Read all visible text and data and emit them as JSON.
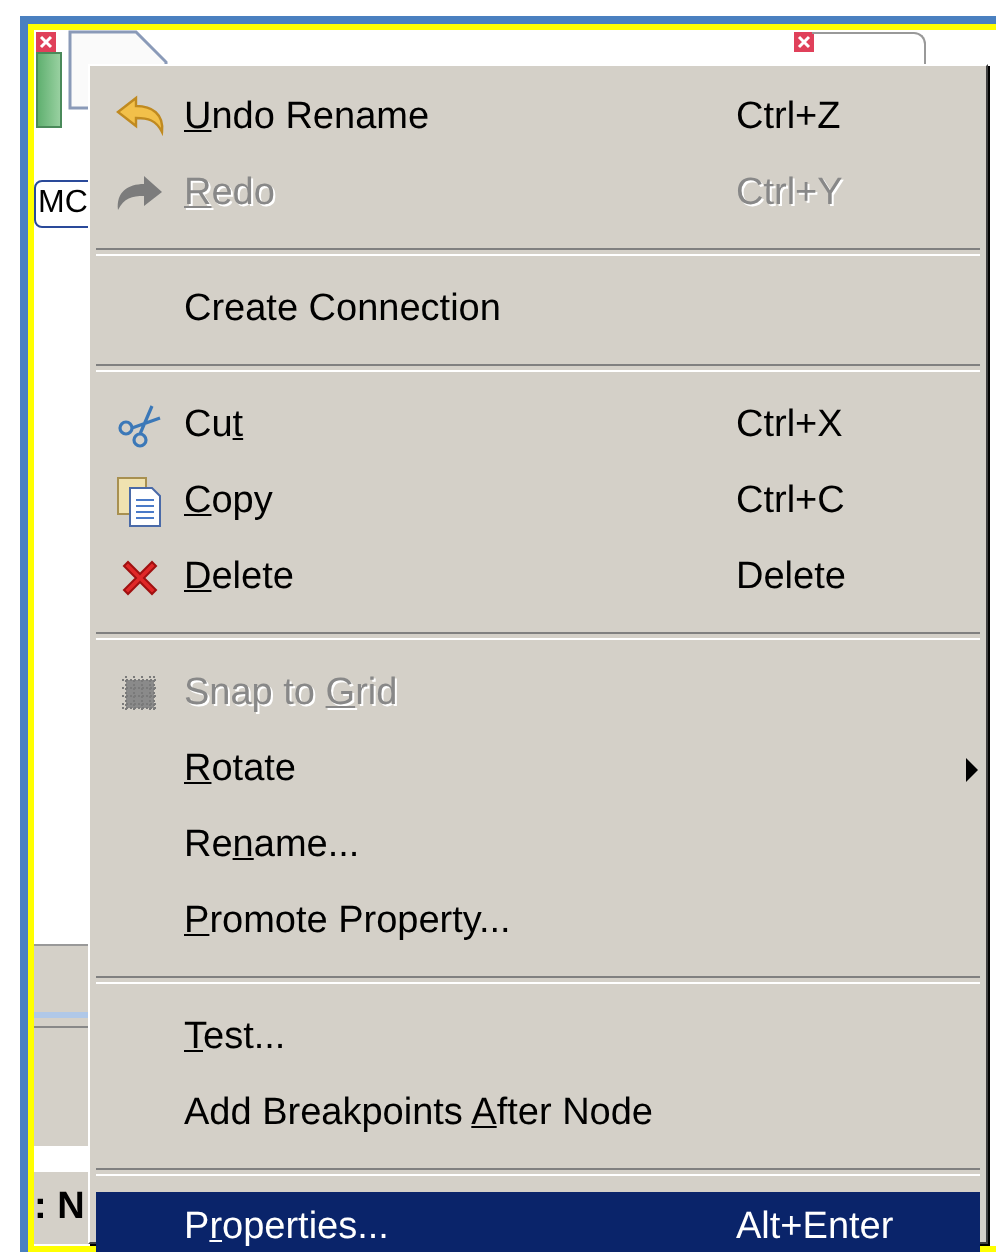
{
  "editor": {
    "node_label": "MC",
    "row_text": ": N"
  },
  "menu": {
    "items": [
      {
        "kind": "item",
        "mnemonic": "U",
        "after": "ndo Rename",
        "shortcut": "Ctrl+Z",
        "disabled": false,
        "selected": false,
        "submenu": false
      },
      {
        "kind": "item",
        "mnemonic": "R",
        "after": "edo",
        "shortcut": "Ctrl+Y",
        "disabled": true,
        "selected": false,
        "submenu": false
      },
      {
        "kind": "separator"
      },
      {
        "kind": "item",
        "before": "Create Connection",
        "disabled": false,
        "selected": false,
        "submenu": false
      },
      {
        "kind": "separator"
      },
      {
        "kind": "item",
        "before": "Cu",
        "mnemonic": "t",
        "shortcut": "Ctrl+X",
        "disabled": false,
        "selected": false,
        "submenu": false
      },
      {
        "kind": "item",
        "mnemonic": "C",
        "after": "opy",
        "shortcut": "Ctrl+C",
        "disabled": false,
        "selected": false,
        "submenu": false
      },
      {
        "kind": "item",
        "mnemonic": "D",
        "after": "elete",
        "shortcut": "Delete",
        "disabled": false,
        "selected": false,
        "submenu": false
      },
      {
        "kind": "separator"
      },
      {
        "kind": "item",
        "before": "Snap to ",
        "mnemonic": "G",
        "after": "rid",
        "disabled": true,
        "selected": false,
        "submenu": false
      },
      {
        "kind": "item",
        "mnemonic": "R",
        "after": "otate",
        "disabled": false,
        "selected": false,
        "submenu": true
      },
      {
        "kind": "item",
        "before": "Re",
        "mnemonic": "n",
        "after": "ame...",
        "disabled": false,
        "selected": false,
        "submenu": false
      },
      {
        "kind": "item",
        "mnemonic": "P",
        "after": "romote Property...",
        "disabled": false,
        "selected": false,
        "submenu": false
      },
      {
        "kind": "separator"
      },
      {
        "kind": "item",
        "mnemonic": "T",
        "after": "est...",
        "disabled": false,
        "selected": false,
        "submenu": false
      },
      {
        "kind": "item",
        "before": "Add Breakpoints ",
        "mnemonic": "A",
        "after": "fter Node",
        "disabled": false,
        "selected": false,
        "submenu": false
      },
      {
        "kind": "separator"
      },
      {
        "kind": "item",
        "before": "P",
        "mnemonic": "r",
        "after": "operties...",
        "shortcut": "Alt+Enter",
        "disabled": false,
        "selected": true,
        "submenu": false
      }
    ]
  }
}
